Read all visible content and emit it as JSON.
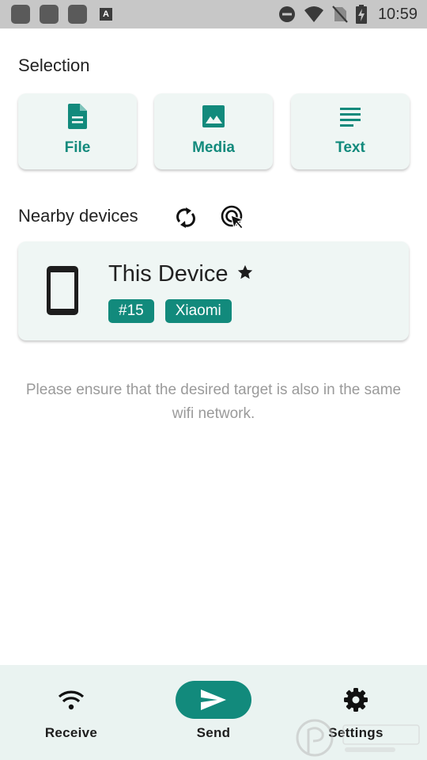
{
  "status_bar": {
    "time": "10:59",
    "notification_letter": "A",
    "icons": [
      "app-notification-icon",
      "app-notification-icon",
      "app-notification-icon",
      "do-not-disturb-icon",
      "wifi-signal-icon",
      "no-sim-icon",
      "battery-charging-icon"
    ]
  },
  "selection": {
    "title": "Selection",
    "cards": [
      {
        "label": "File",
        "icon": "file-icon"
      },
      {
        "label": "Media",
        "icon": "image-icon"
      },
      {
        "label": "Text",
        "icon": "text-icon"
      }
    ]
  },
  "nearby": {
    "title": "Nearby devices",
    "icons": [
      "refresh-icon",
      "manual-select-icon"
    ],
    "device": {
      "name": "This Device",
      "icon": "phone-icon",
      "favorite_icon": "star-icon",
      "tags": [
        "#15",
        "Xiaomi"
      ]
    },
    "hint": "Please ensure that the desired target is also in the same wifi network."
  },
  "bottom_nav": {
    "items": [
      {
        "label": "Receive",
        "icon": "wifi-icon",
        "active": false
      },
      {
        "label": "Send",
        "icon": "send-icon",
        "active": true
      },
      {
        "label": "Settings",
        "icon": "gear-icon",
        "active": false
      }
    ]
  },
  "colors": {
    "accent": "#128a7c",
    "card_bg": "#eff6f4",
    "nav_bg": "#eaf3f1",
    "status_bar_bg": "#c7c7c7",
    "hint_text": "#9a9a9a"
  }
}
